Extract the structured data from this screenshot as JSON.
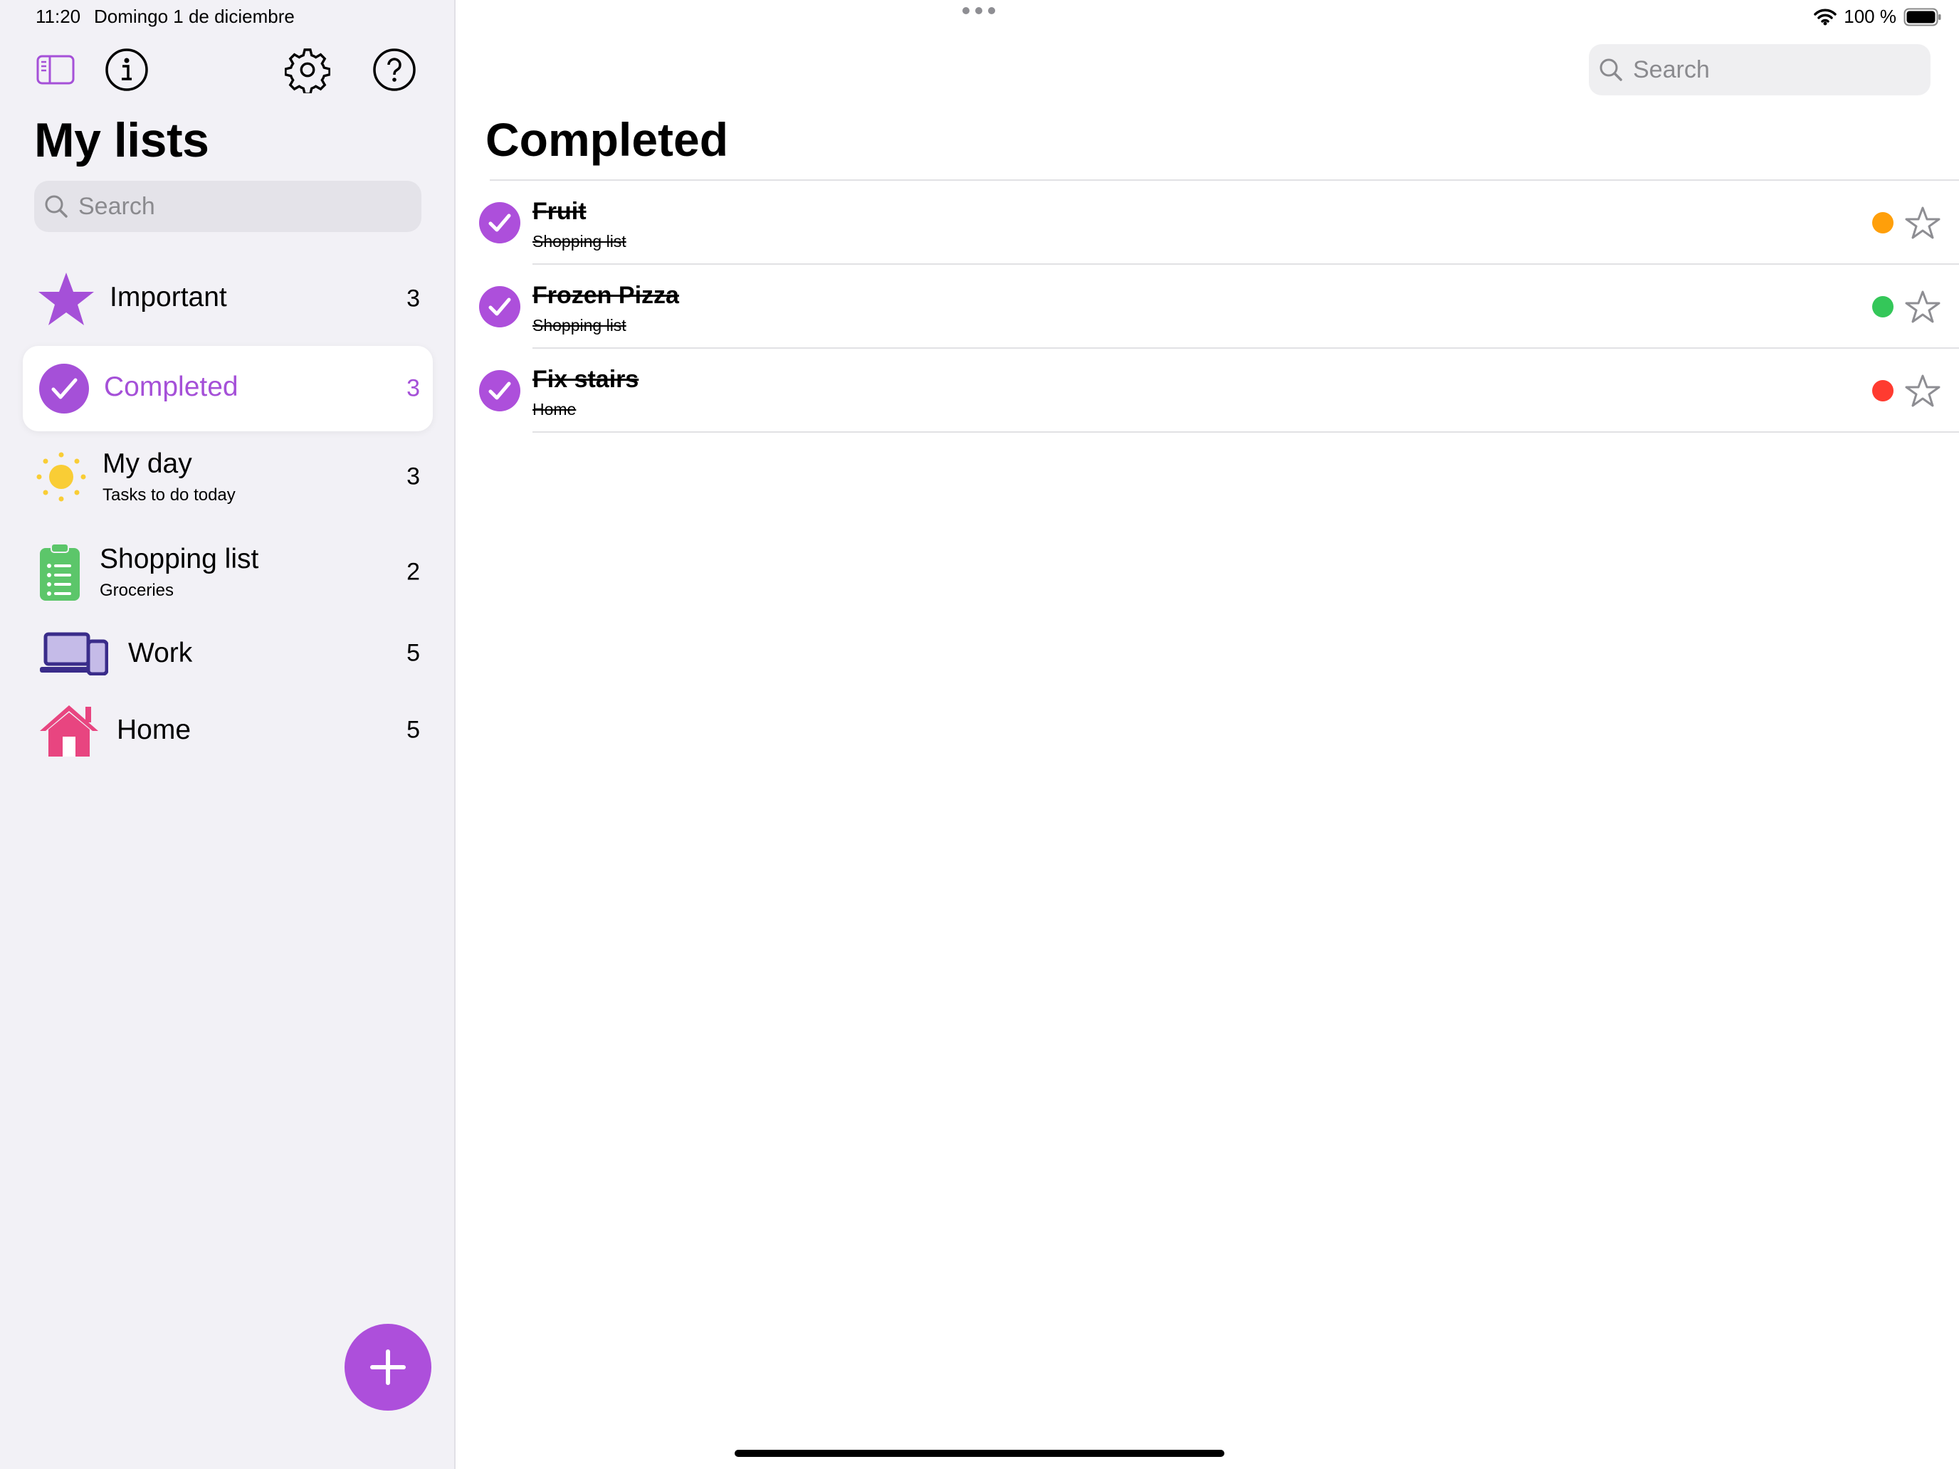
{
  "status": {
    "time": "11:20",
    "date": "Domingo 1 de diciembre",
    "battery": "100 %"
  },
  "sidebar": {
    "title": "My lists",
    "search_placeholder": "Search",
    "items": [
      {
        "label": "Important",
        "sub": "",
        "count": "3",
        "icon": "star-icon"
      },
      {
        "label": "Completed",
        "sub": "",
        "count": "3",
        "icon": "check-circle-icon",
        "selected": true
      },
      {
        "label": "My day",
        "sub": "Tasks to do today",
        "count": "3",
        "icon": "sun-icon"
      },
      {
        "label": "Shopping list",
        "sub": "Groceries",
        "count": "2",
        "icon": "clipboard-icon"
      },
      {
        "label": "Work",
        "sub": "",
        "count": "5",
        "icon": "laptop-phone-icon"
      },
      {
        "label": "Home",
        "sub": "",
        "count": "5",
        "icon": "house-icon"
      }
    ]
  },
  "main": {
    "title": "Completed",
    "search_placeholder": "Search",
    "tasks": [
      {
        "title": "Fruit",
        "list": "Shopping list",
        "dot_color": "#ff9f0a"
      },
      {
        "title": "Frozen Pizza",
        "list": "Shopping list",
        "dot_color": "#34c759"
      },
      {
        "title": "Fix stairs",
        "list": "Home",
        "dot_color": "#ff3b30"
      }
    ]
  },
  "colors": {
    "accent": "#ad4fdb",
    "sidebar_bg": "#f2f1f6"
  }
}
